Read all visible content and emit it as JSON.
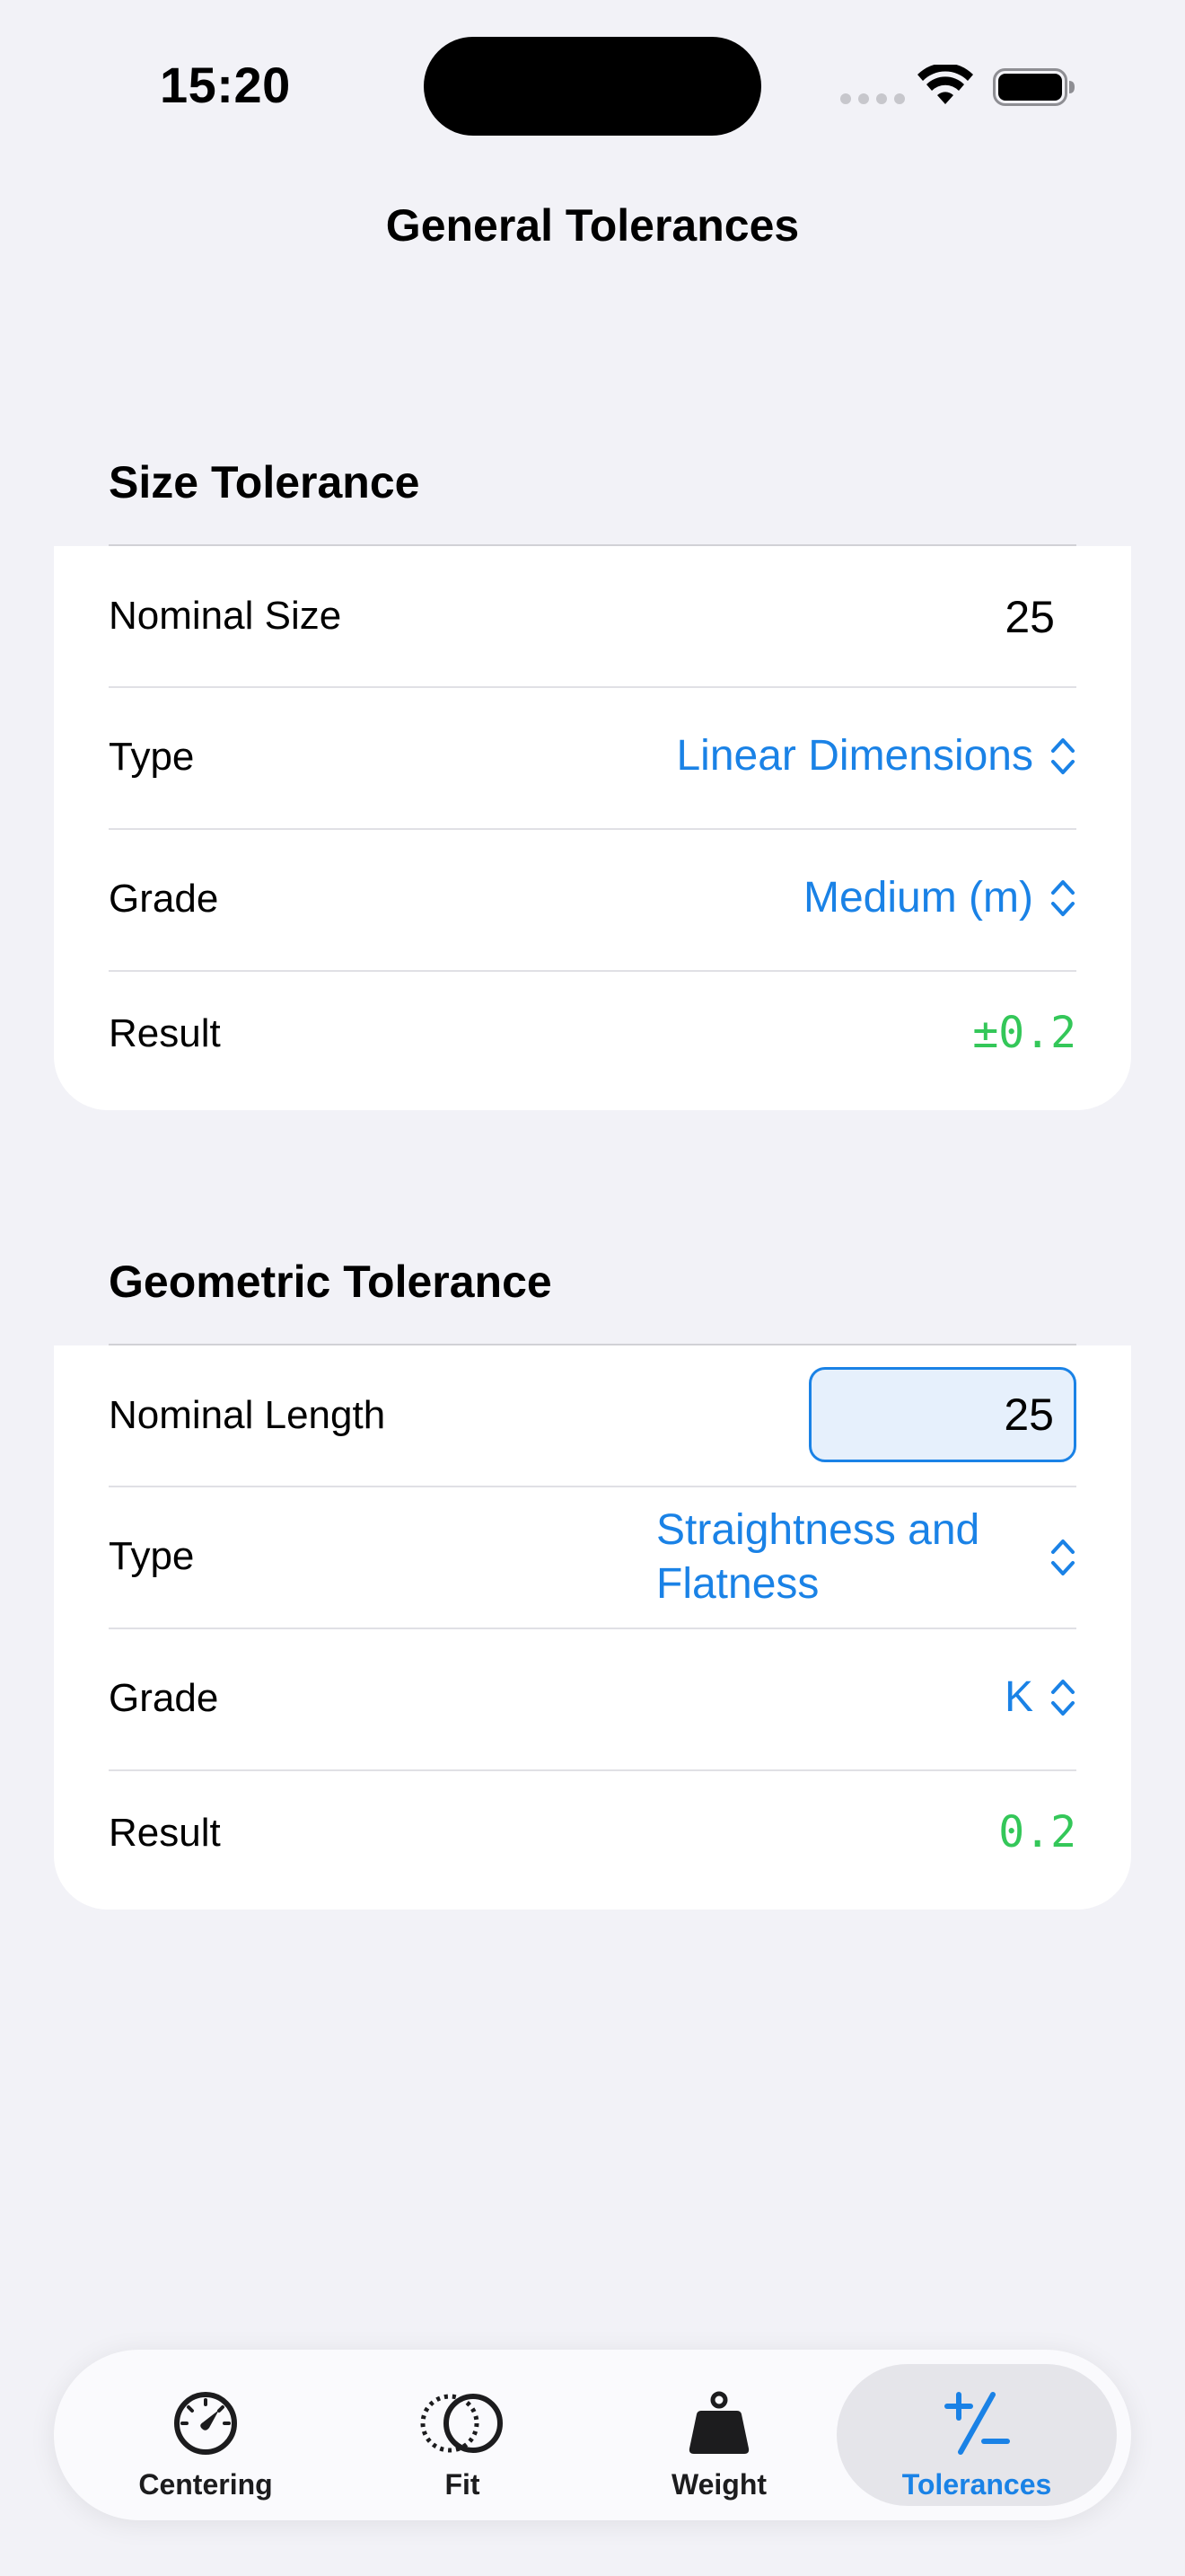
{
  "status_bar": {
    "time": "15:20"
  },
  "nav": {
    "title": "General Tolerances"
  },
  "size_section": {
    "header": "Size Tolerance",
    "nominal_label": "Nominal Size",
    "nominal_value": "25",
    "type_label": "Type",
    "type_value": "Linear Dimensions",
    "grade_label": "Grade",
    "grade_value": "Medium (m)",
    "result_label": "Result",
    "result_value": "±0.2"
  },
  "geometric_section": {
    "header": "Geometric Tolerance",
    "nominal_label": "Nominal Length",
    "nominal_value": "25",
    "type_label": "Type",
    "type_value_line1": "Straightness and",
    "type_value_line2": "Flatness",
    "grade_label": "Grade",
    "grade_value": "K",
    "result_label": "Result",
    "result_value": "0.2"
  },
  "tab_bar": {
    "tabs": [
      {
        "label": "Centering",
        "icon": "gauge-icon"
      },
      {
        "label": "Fit",
        "icon": "circles-overlap-icon"
      },
      {
        "label": "Weight",
        "icon": "weight-icon"
      },
      {
        "label": "Tolerances",
        "icon": "plus-minus-icon"
      }
    ],
    "selected_index": 3
  },
  "colors": {
    "accent": "#1a82e6",
    "result": "#34c759",
    "background": "#f2f2f7"
  }
}
